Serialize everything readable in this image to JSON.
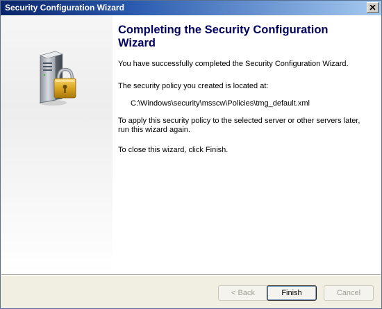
{
  "window": {
    "title": "Security Configuration Wizard"
  },
  "side_panel": {
    "icon": "server-lock-icon"
  },
  "main": {
    "heading": "Completing the Security Configuration Wizard",
    "paragraph_success": "You have successfully completed the Security Configuration Wizard.",
    "paragraph_location": "The security policy you created is located at:",
    "policy_path": "C:\\Windows\\security\\msscw\\Policies\\tmg_default.xml",
    "paragraph_apply": "To apply this security policy to the selected server or other servers later, run this wizard again.",
    "paragraph_close": "To close this wizard, click Finish."
  },
  "buttons": {
    "back": "< Back",
    "finish": "Finish",
    "cancel": "Cancel"
  },
  "colors": {
    "heading": "#000060",
    "titlebar_start": "#0a246a",
    "titlebar_end": "#a6caf0"
  }
}
